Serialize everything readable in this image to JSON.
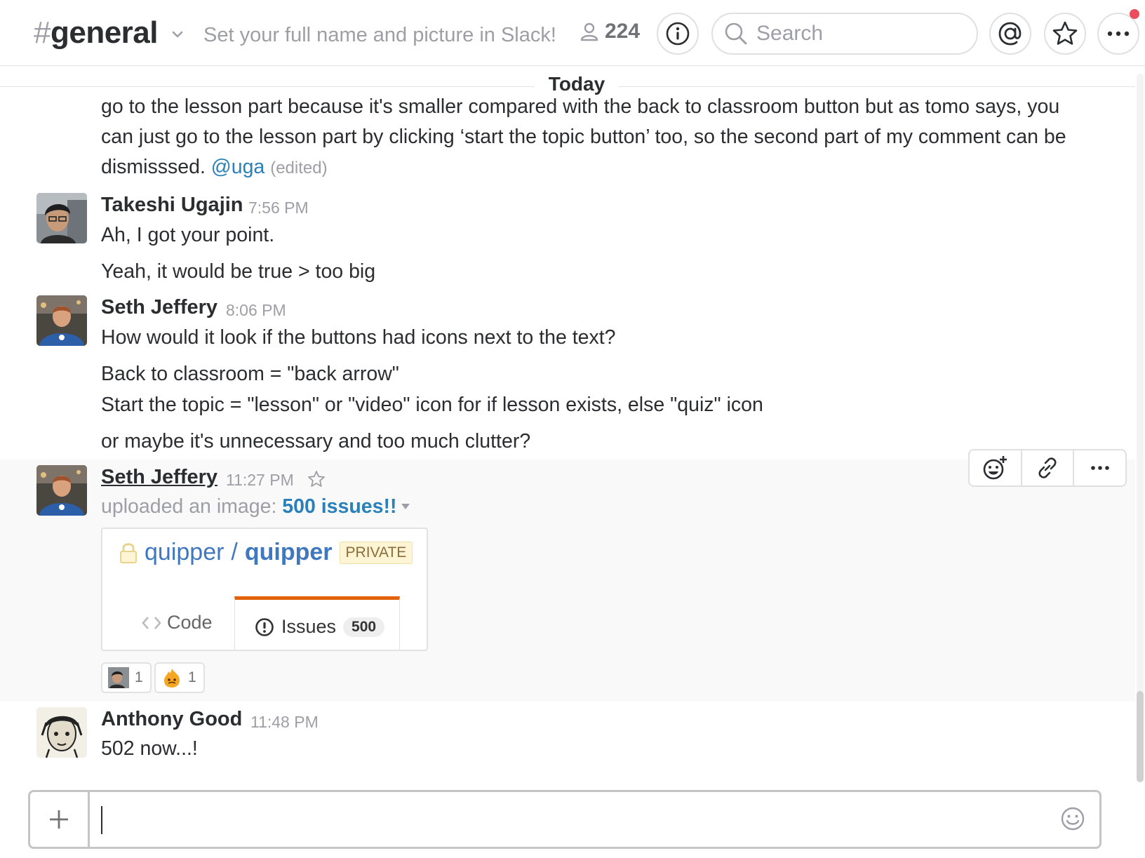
{
  "header": {
    "channel_hash": "#",
    "channel_name": "general",
    "topic": "Set your full name and picture in Slack!",
    "member_count": "224",
    "search_placeholder": "Search",
    "icons": [
      "chevron-down-icon",
      "member-icon",
      "info-icon",
      "search-icon",
      "at-mention-icon",
      "star-icon",
      "more-icon"
    ],
    "notification_dot_color": "#eb4d5c"
  },
  "divider": {
    "label": "Today"
  },
  "messages": [
    {
      "continued": true,
      "lines": [
        "go to the lesson part because it's smaller compared with the back to classroom button  but as tomo says, you",
        "can just go to the lesson part by clicking ‘start the topic button’ too, so the second part of my comment can be",
        "dismisssed."
      ],
      "mention": "@uga",
      "edited": "(edited)"
    },
    {
      "sender": "Takeshi Ugajin",
      "time": "7:56 PM",
      "lines": [
        "Ah, I got your point.",
        "Yeah, it would be true > too big"
      ]
    },
    {
      "sender": "Seth Jeffery",
      "time": "8:06 PM",
      "lines": [
        "How would it look if the buttons had icons next to the text?",
        "Back to classroom = \"back arrow\"",
        "Start the topic = \"lesson\" or \"video\" icon for if lesson exists, else \"quiz\" icon",
        "or maybe it's unnecessary and too much clutter?"
      ]
    },
    {
      "sender": "Seth Jeffery",
      "time": "11:27 PM",
      "upload_prefix": "uploaded an image:",
      "file_title": "500 issues!!",
      "file": {
        "owner": "quipper",
        "separator": "/",
        "repo": "quipper",
        "visibility": "PRIVATE",
        "tab_code": "Code",
        "tab_issues": "Issues",
        "issues_count": "500"
      },
      "reactions": [
        {
          "emoji": "custom-avatar-emoji",
          "count": "1"
        },
        {
          "emoji": "fire-face-emoji",
          "count": "1"
        }
      ],
      "actions": [
        "add-reaction-icon",
        "link-icon",
        "more-actions-icon"
      ]
    },
    {
      "sender": "Anthony Good",
      "time": "11:48 PM",
      "lines": [
        "502 now...!"
      ]
    }
  ],
  "composer": {
    "placeholder": "",
    "value": ""
  },
  "colors": {
    "link": "#2a80b9",
    "muted": "#9e9ea6",
    "text": "#2c2d30",
    "github_blue": "#4078c0",
    "issues_tab_accent": "#e36209"
  }
}
